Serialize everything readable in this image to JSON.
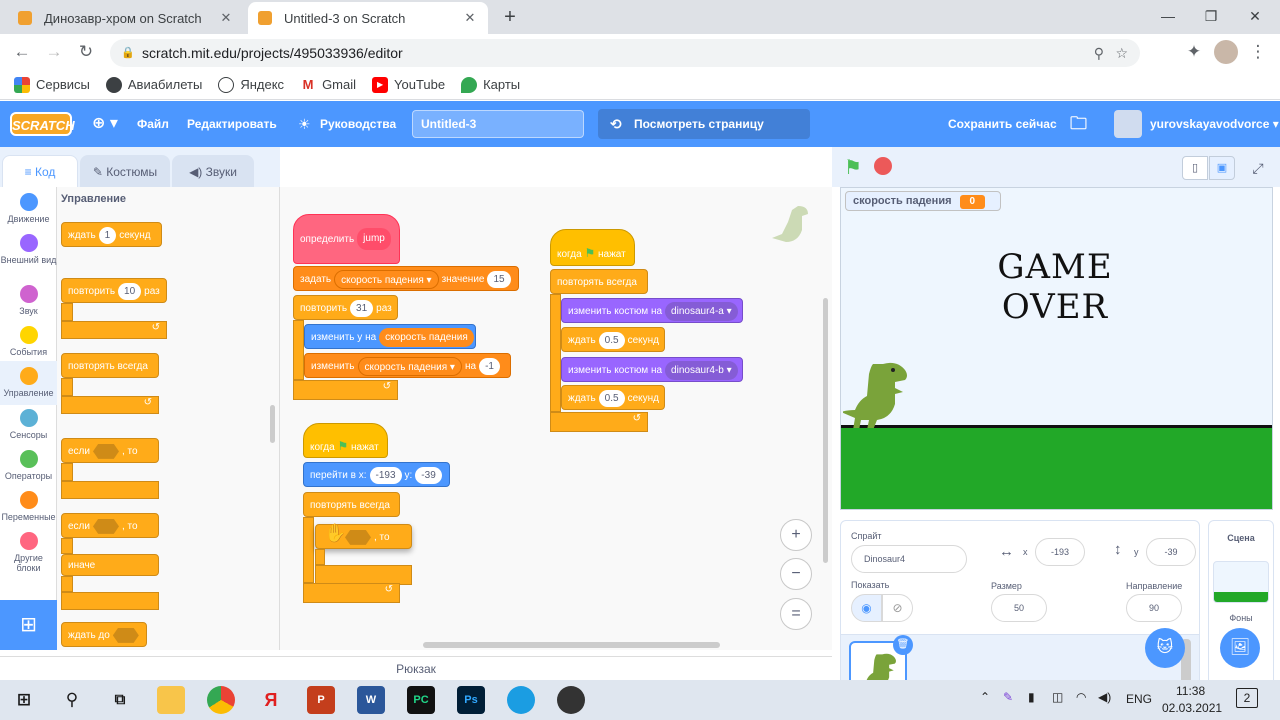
{
  "browser": {
    "tabs": [
      {
        "title": "Динозавр-хром on Scratch"
      },
      {
        "title": "Untitled-3 on Scratch"
      }
    ],
    "url": "scratch.mit.edu/projects/495033936/editor",
    "bookmarks": [
      "Сервисы",
      "Авиабилеты",
      "Яндекс",
      "Gmail",
      "YouTube",
      "Карты"
    ]
  },
  "menu": {
    "logo": "SCRATCH",
    "file": "Файл",
    "edit": "Редактировать",
    "tutorials": "Руководства",
    "project_title": "Untitled-3",
    "view_page": "Посмотреть страницу проекта",
    "save_now": "Сохранить сейчас",
    "username": "yurovskayavodvorce"
  },
  "editor_tabs": [
    "Код",
    "Костюмы",
    "Звуки"
  ],
  "categories": [
    {
      "label": "Движение",
      "color": "#4c97ff"
    },
    {
      "label": "Внешний вид",
      "color": "#9966ff"
    },
    {
      "label": "Звук",
      "color": "#cf63cf"
    },
    {
      "label": "События",
      "color": "#ffd500"
    },
    {
      "label": "Управление",
      "color": "#ffab19"
    },
    {
      "label": "Сенсоры",
      "color": "#5cb1d6"
    },
    {
      "label": "Операторы",
      "color": "#59c059"
    },
    {
      "label": "Переменные",
      "color": "#ff8c1a"
    },
    {
      "label": "Другие блоки",
      "color": "#ff6680"
    }
  ],
  "palette": {
    "heading": "Управление",
    "wait": "ждать",
    "wait_val": "1",
    "seconds": "секунд",
    "repeat": "повторить",
    "repeat_val": "10",
    "times": "раз",
    "forever": "повторять всегда",
    "if": "если",
    "then": ", то",
    "else": "иначе",
    "wait_until": "ждать до"
  },
  "scripts": {
    "define": "определить",
    "define_name": "jump",
    "set": "задать",
    "var_name": "скорость падения",
    "to_value": "значение",
    "set_val": "15",
    "repeat": "повторить",
    "repeat_val": "31",
    "times": "раз",
    "change_y": "изменить у на",
    "change": "изменить",
    "by": "на",
    "change_val": "-1",
    "when": "когда",
    "clicked": "нажат",
    "goto": "перейти в x:",
    "x_val": "-193",
    "y_label": "у:",
    "y_val": "-39",
    "forever": "повторять всегда",
    "if_then": ", то",
    "switch_costume": "изменить костюм на",
    "costume_a": "dinosaur4-a",
    "costume_b": "dinosaur4-b",
    "wait": "ждать",
    "wait_val": "0.5",
    "seconds": "секунд"
  },
  "backpack": "Рюкзак",
  "stage": {
    "monitor_label": "скорость падения",
    "monitor_value": "0",
    "game_over_text": "GAME OVER"
  },
  "sprite_info": {
    "sprite_label": "Спрайт",
    "sprite_name": "Dinosaur4",
    "x_label": "x",
    "x": "-193",
    "y_label": "y",
    "y": "-39",
    "show_label": "Показать",
    "size_label": "Размер",
    "size": "50",
    "direction_label": "Направление",
    "direction": "90"
  },
  "scene": {
    "label": "Сцена",
    "backdrops": "Фоны"
  },
  "taskbar": {
    "lang": "ENG",
    "time": "11:38",
    "date": "02.03.2021",
    "notif_count": "2"
  }
}
